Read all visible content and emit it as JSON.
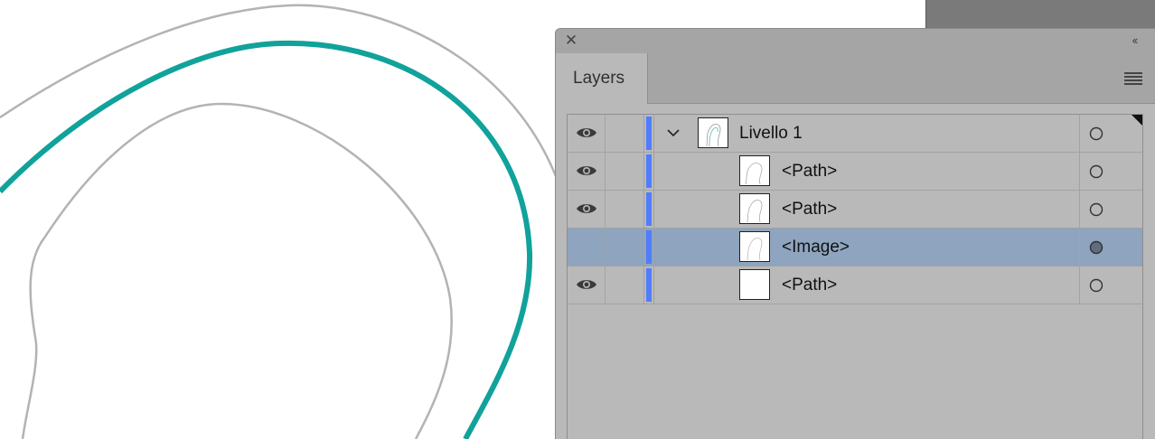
{
  "panel": {
    "close_symbol": "✕",
    "collapse_symbol": "‹‹",
    "tab_label": "Layers",
    "menu_icon": "hamburger-icon"
  },
  "colors": {
    "artwork_teal": "#10a29b",
    "artwork_gray": "#b3b3b3",
    "layer_color_bar": "#4f7dff",
    "selected_row": "#8ea4bf"
  },
  "layers": [
    {
      "name": "Livello 1",
      "visible": true,
      "expanded": true,
      "thumbnail": "layer-thumb",
      "selected": false
    },
    {
      "name": "<Path>",
      "visible": true,
      "thumbnail": "path-thumb",
      "selected": false
    },
    {
      "name": "<Path>",
      "visible": true,
      "thumbnail": "path-thumb",
      "selected": false
    },
    {
      "name": "<Image>",
      "visible": false,
      "thumbnail": "path-thumb",
      "selected": true
    },
    {
      "name": "<Path>",
      "visible": true,
      "thumbnail": "blank-thumb",
      "selected": false
    }
  ]
}
